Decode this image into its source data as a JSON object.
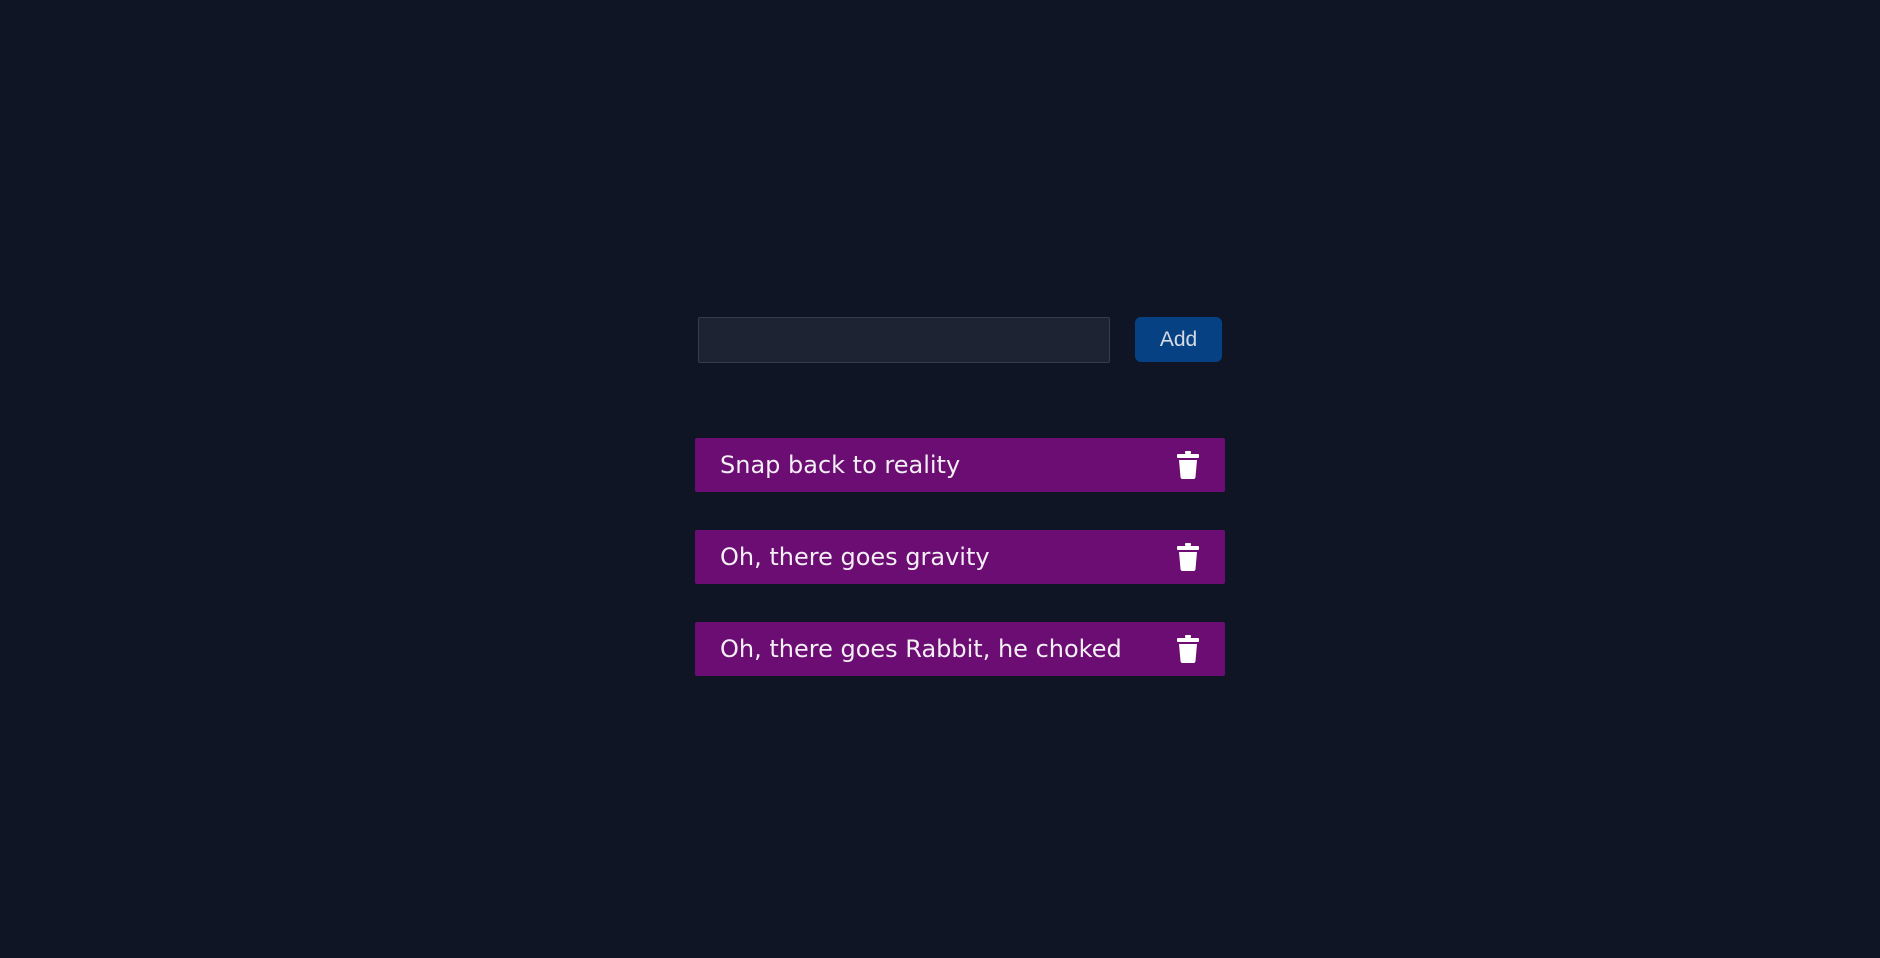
{
  "form": {
    "input_value": "",
    "input_placeholder": "",
    "add_label": "Add"
  },
  "tasks": [
    {
      "text": "Snap back to reality",
      "icon": "trash-icon"
    },
    {
      "text": "Oh, there goes gravity",
      "icon": "trash-icon"
    },
    {
      "text": "Oh, there goes Rabbit, he choked",
      "icon": "trash-icon"
    }
  ],
  "colors": {
    "background": "#0f1524",
    "input_background": "#1d2332",
    "add_button": "#064283",
    "task_item": "#6b0d72",
    "text": "#ffffff"
  }
}
